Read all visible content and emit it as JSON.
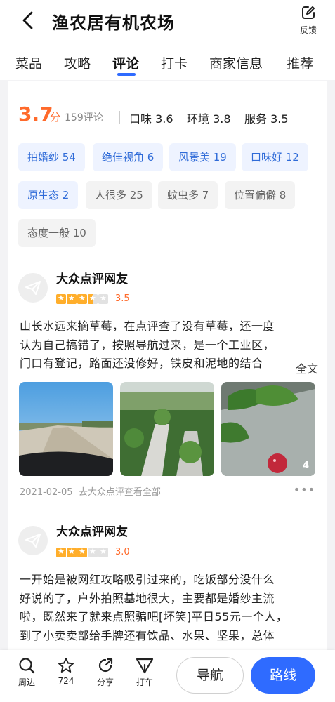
{
  "header": {
    "title": "渔农居有机农场",
    "feedback_label": "反馈"
  },
  "tabs": [
    {
      "label": "菜品",
      "active": false
    },
    {
      "label": "攻略",
      "active": false
    },
    {
      "label": "评论",
      "active": true
    },
    {
      "label": "打卡",
      "active": false
    },
    {
      "label": "商家信息",
      "active": false
    },
    {
      "label": "推荐",
      "active": false
    }
  ],
  "rating": {
    "score": "3.7",
    "unit": "分",
    "count": "159评论",
    "taste": "口味 3.6",
    "environment": "环境 3.8",
    "service": "服务 3.5",
    "accent_color": "#ff6a2b"
  },
  "tags": [
    {
      "label": "拍婚纱 54",
      "tone": "positive"
    },
    {
      "label": "绝佳视角 6",
      "tone": "positive"
    },
    {
      "label": "风景美 19",
      "tone": "positive"
    },
    {
      "label": "口味好 12",
      "tone": "positive"
    },
    {
      "label": "原生态 2",
      "tone": "positive"
    },
    {
      "label": "人很多 25",
      "tone": "neutral"
    },
    {
      "label": "蚊虫多 7",
      "tone": "neutral"
    },
    {
      "label": "位置偏僻 8",
      "tone": "neutral"
    },
    {
      "label": "态度一般 10",
      "tone": "neutral"
    }
  ],
  "reviews": [
    {
      "user": "大众点评网友",
      "stars": 3.5,
      "score": "3.5",
      "lines": [
        "山长水远来摘草莓，在点评查了没有草莓，还一度",
        "认为自己搞错了，按照导航过来，是一个工业区，",
        "门口有登记，路面还没修好，铁皮和泥地的结合"
      ],
      "more_label": "全文",
      "photo_count_badge": "4",
      "date": "2021-02-05",
      "source_link": "去大众点评查看全部"
    },
    {
      "user": "大众点评网友",
      "stars": 3,
      "score": "3.0",
      "lines": [
        "一开始是被网红攻略吸引过来的，吃饭部分没什么",
        "好说的了，户外拍照基地很大，主要都是婚纱主流",
        "啦，既然来了就来点照骗吧[坏笑]平日55元一个人，",
        "到了小卖卖部给手牌还有饮品、水果、坚果，总体"
      ]
    }
  ],
  "bottom_bar": {
    "nearby": "周边",
    "favorites": "724",
    "share": "分享",
    "taxi": "打车",
    "navigate": "导航",
    "route": "路线",
    "primary_color": "#2f6bff"
  }
}
